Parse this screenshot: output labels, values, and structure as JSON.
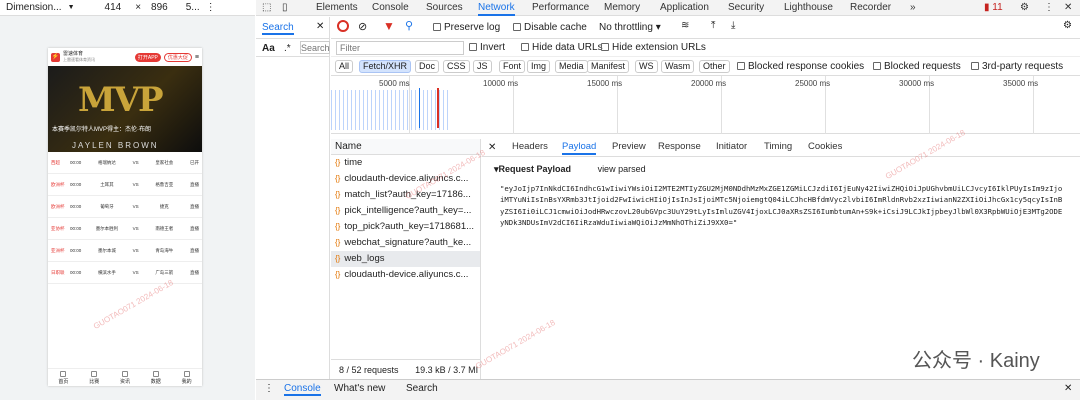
{
  "device": {
    "preset": "Dimension...",
    "width": "414",
    "x": "×",
    "height": "896",
    "zoom": "5..."
  },
  "phone": {
    "brand": "雷速体育",
    "brand_sub": "上雷速看体育资讯",
    "btn_open": "打开APP",
    "btn_promo": "优惠大促",
    "promo_badge": "NEW",
    "hero_caption": "本赛季凯尔特人MVP得主：杰伦·布朗",
    "hero_name": "JAYLEN BROWN",
    "hero_text": "MVP",
    "rows": [
      {
        "league": "西超",
        "time": "00:00",
        "home": "格瑞纳达",
        "away": "皇家社会",
        "status": "已开"
      },
      {
        "league": "欧洲杯",
        "time": "00:00",
        "home": "土耳其",
        "away": "格鲁吉亚",
        "status": "直播"
      },
      {
        "league": "欧洲杯",
        "time": "00:00",
        "home": "葡萄牙",
        "away": "捷克",
        "status": "直播"
      },
      {
        "league": "亚协杯",
        "time": "00:00",
        "home": "墨尔本胜利",
        "away": "南德王者",
        "status": "直播"
      },
      {
        "league": "亚洲杯",
        "time": "00:00",
        "home": "墨尔本城",
        "away": "青岛海牛",
        "status": "直播"
      },
      {
        "league": "日职联",
        "time": "00:00",
        "home": "横滨水手",
        "away": "广岛三箭",
        "status": "直播"
      }
    ],
    "nav": [
      "首页",
      "比赛",
      "资讯",
      "数据",
      "我的"
    ]
  },
  "devtools": {
    "tabs": [
      "Elements",
      "Console",
      "Sources",
      "Network",
      "Performance",
      "Memory",
      "Application",
      "Security",
      "Lighthouse",
      "Recorder"
    ],
    "more": "»",
    "errors": "11",
    "active_tab": "Network",
    "search_tab": "Search",
    "search_aa": "Aa",
    "search_regex": ".*",
    "search_placeholder": "Search",
    "preserve_log": "Preserve log",
    "disable_cache": "Disable cache",
    "throttling": "No throttling",
    "filter_placeholder": "Filter",
    "invert": "Invert",
    "hide_data": "Hide data URLs",
    "hide_ext": "Hide extension URLs",
    "types": [
      "All",
      "Fetch/XHR",
      "Doc",
      "CSS",
      "JS",
      "Font",
      "Img",
      "Media",
      "Manifest",
      "WS",
      "Wasm",
      "Other"
    ],
    "blocked_cookies": "Blocked response cookies",
    "blocked_requests": "Blocked requests",
    "third_party": "3rd-party requests",
    "ticks": [
      "5000 ms",
      "10000 ms",
      "15000 ms",
      "20000 ms",
      "25000 ms",
      "30000 ms",
      "35000 ms"
    ],
    "name_header": "Name",
    "requests": [
      "time",
      "cloudauth-device.aliyuncs.c...",
      "match_list?auth_key=17186...",
      "pick_intelligence?auth_key=...",
      "top_pick?auth_key=1718681...",
      "webchat_signature?auth_ke...",
      "web_logs",
      "cloudauth-device.aliyuncs.c..."
    ],
    "status_requests": "8 / 52 requests",
    "status_size": "19.3 kB / 3.7 MI",
    "detail_tabs": [
      "Headers",
      "Payload",
      "Preview",
      "Response",
      "Initiator",
      "Timing",
      "Cookies"
    ],
    "payload_title": "▾Request Payload",
    "view_parsed": "view parsed",
    "payload_raw": "\"eyJoIjp7InNkdCI6IndhcG1wIiwiYWsiOiI2MTE2MTIyZGU2MjM0NDdhMzMxZGE1ZGMiLCJzdiI6IjEuNy42IiwiZHQiOiJpUGhvbmUiLCJvcyI6IklPUyIsIm9zIjoiMTYuNiIsInBsYXRmb3JtIjoid2FwIiwicHIiOjIsInJsIjoiMTc5NjoiemgtQ04iLCJhcHBfdmVyc2lvbiI6ImRldnRvb2xzIiwianN2ZXIiOiJhcGx1cy5qcyIsInByZSI6Ii0iLCJ1cmwiOiJodHRwczovL20ubGVpc3UuY29tLyIsImluZGV4IjoxLCJ0aXRsZSI6IumbtumAn+S9k+iCsiJ9LCJkIjpbeyJlbWl0X3RpbWUiOjE3MTg2ODEyNDk3NDUsImV2dCI6IiRzaWduIiwiaWQiOiJzMmNhOThiZiJ9XX0=\"",
    "console_tabs": [
      "Console",
      "What's new",
      "Search"
    ]
  },
  "watermark": "GUOTAO071 2024-06-18",
  "footer_brand": "公众号 · Kainy"
}
